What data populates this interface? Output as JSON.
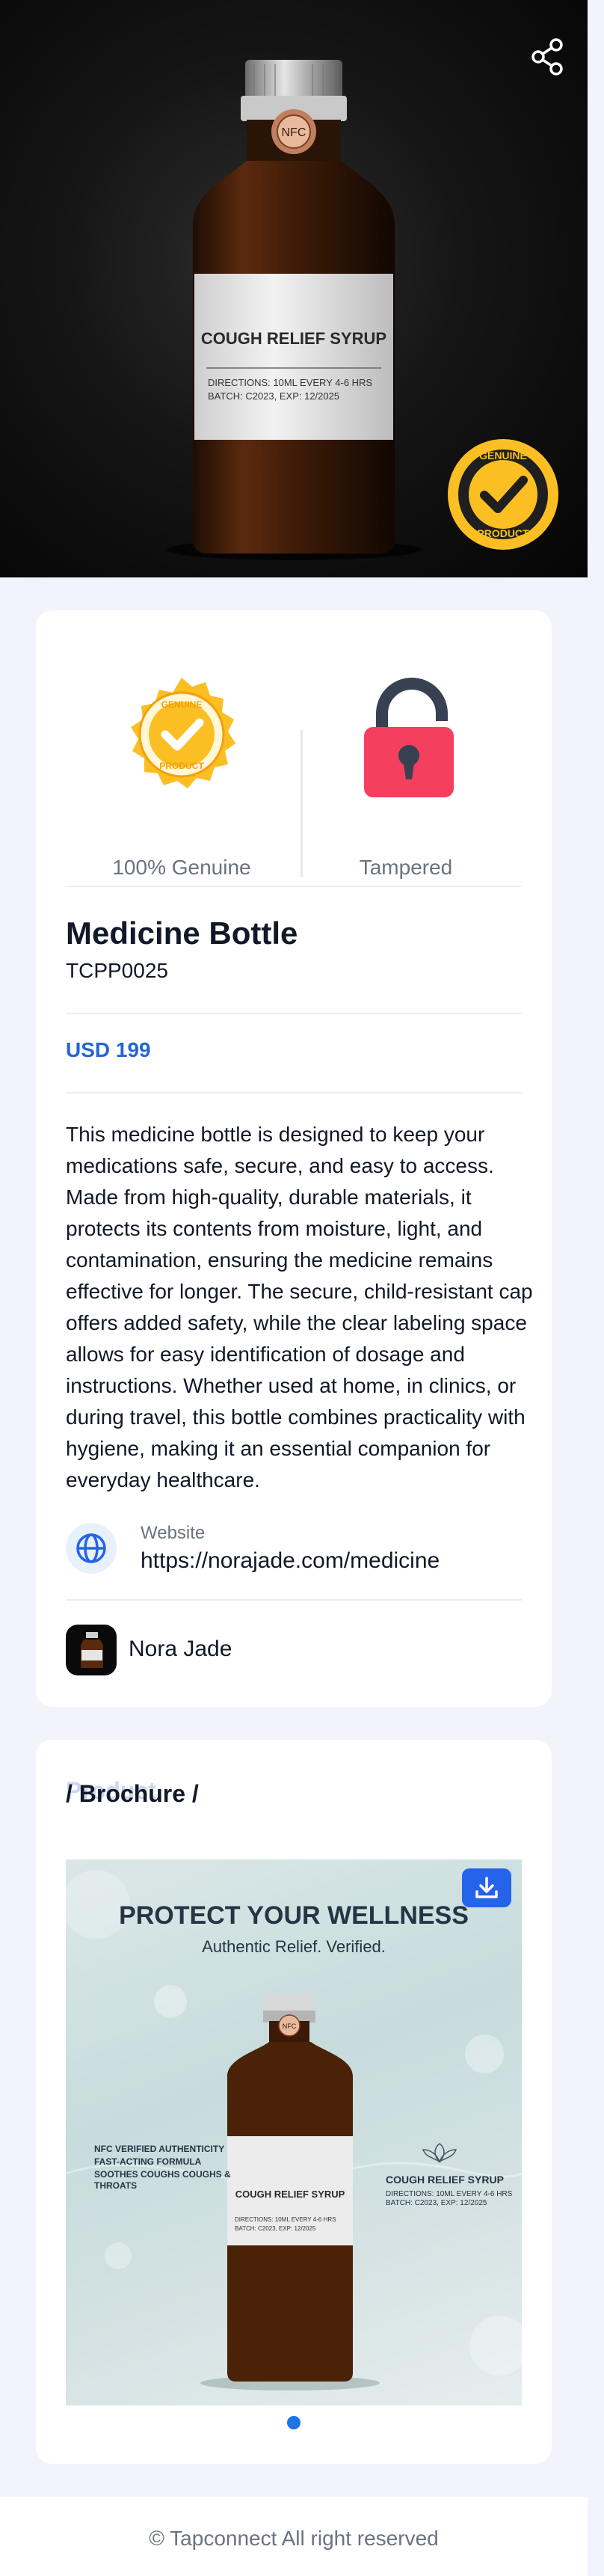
{
  "hero": {
    "bottle_label_title": "COUGH RELIEF SYRUP",
    "bottle_label_directions": "DIRECTIONS: 10ML EVERY 4-6 HRS",
    "bottle_label_batch": "BATCH: C2023, EXP: 12/2025",
    "cap_text": "NFC",
    "badge_top": "GENUINE",
    "badge_bottom": "PRODUCT"
  },
  "status": {
    "genuine_label": "100% Genuine",
    "tampered_label": "Tampered",
    "badge_top": "GENUINE",
    "badge_bottom": "PRODUCT"
  },
  "product": {
    "title": "Medicine Bottle",
    "sku": "TCPP0025",
    "price": "USD 199",
    "description": "This medicine bottle is designed to keep your medications safe, secure, and easy to access. Made from high-quality, durable materials, it protects its contents from moisture, light, and contamination, ensuring the medicine remains effective for longer. The secure, child-resistant cap offers added safety, while the clear labeling space allows for easy identification of dosage and instructions. Whether used at home, in clinics, or during travel, this bottle combines practicality with hygiene, making it an essential companion for everyday healthcare."
  },
  "website": {
    "label": "Website",
    "url": "https://norajade.com/medicine"
  },
  "owner": {
    "name": "Nora Jade"
  },
  "brochure": {
    "section_title": "/ Brochure /",
    "ghost_title": "Product",
    "headline": "PROTECT YOUR WELLNESS",
    "subheadline": "Authentic Relief. Verified.",
    "bullets": [
      "NFC VERIFIED AUTHENTICITY",
      "FAST-ACTING FORMULA",
      "SOOTHES COUGHS COUGHS & THROATS"
    ],
    "right_title": "COUGH RELIEF SYRUP",
    "right_text": "DIRECTIONS: 10ML EVERY 4-6 HRS BATCH: C2023, EXP: 12/2025",
    "bottle_label_title": "COUGH RELIEF SYRUP",
    "bottle_label_directions": "DIRECTIONS: 10ML EVERY 4-6 HRS",
    "bottle_label_batch": "BATCH: C2023, EXP: 12/2025",
    "cap_text": "NFC",
    "slide_index": 1,
    "slide_count": 1
  },
  "footer": {
    "text": "© Tapconnect All right reserved"
  },
  "colors": {
    "accent": "#2366d1",
    "tamper_red": "#f43f5e",
    "badge_gold": "#fbbf24",
    "page_bg": "#f3f3fb"
  },
  "icons": [
    "share-icon",
    "genuine-badge-icon",
    "unlocked-padlock-icon",
    "globe-icon",
    "download-icon"
  ]
}
